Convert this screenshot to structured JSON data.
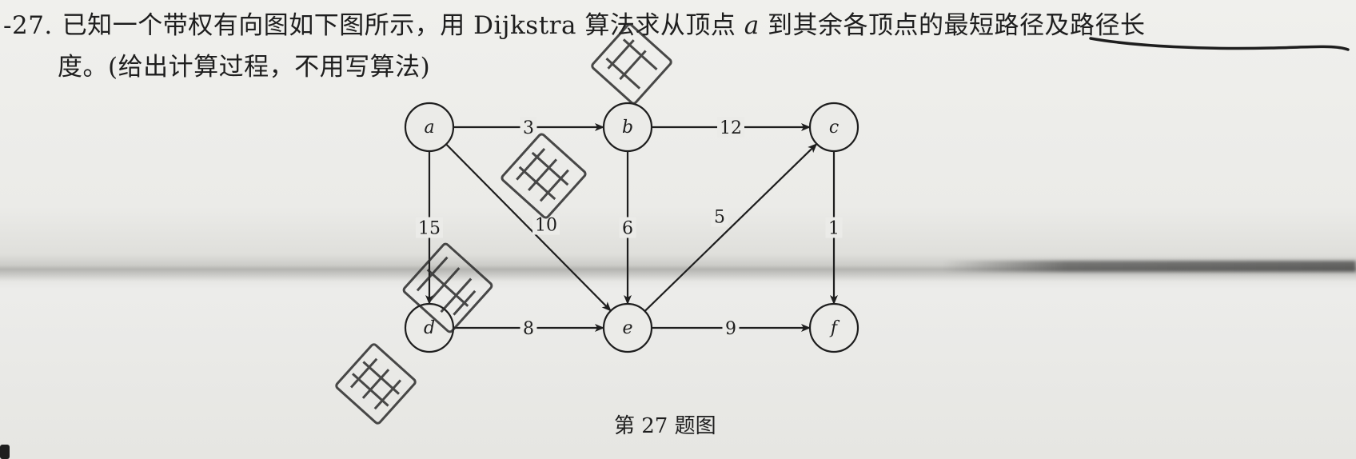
{
  "question": {
    "number": "-27.",
    "line1_before_var": "已知一个带权有向图如下图所示，用 Dijkstra 算法求从顶点 ",
    "start_vertex": "a",
    "line1_after_var": " 到其余各顶点的最短路径及路径长",
    "line2": "度。(给出计算过程，不用写算法)"
  },
  "graph": {
    "nodes": [
      {
        "id": "a",
        "label": "a"
      },
      {
        "id": "b",
        "label": "b"
      },
      {
        "id": "c",
        "label": "c"
      },
      {
        "id": "d",
        "label": "d"
      },
      {
        "id": "e",
        "label": "e"
      },
      {
        "id": "f",
        "label": "f"
      }
    ],
    "edges": [
      {
        "from": "a",
        "to": "b",
        "weight": "3"
      },
      {
        "from": "b",
        "to": "c",
        "weight": "12"
      },
      {
        "from": "a",
        "to": "d",
        "weight": "15"
      },
      {
        "from": "a",
        "to": "e",
        "weight": "10"
      },
      {
        "from": "b",
        "to": "e",
        "weight": "6"
      },
      {
        "from": "e",
        "to": "c",
        "weight": "5"
      },
      {
        "from": "c",
        "to": "f",
        "weight": "1"
      },
      {
        "from": "d",
        "to": "e",
        "weight": "8"
      },
      {
        "from": "e",
        "to": "f",
        "weight": "9"
      }
    ]
  },
  "caption": "第 27 题图",
  "colors": {
    "ink": "#1e1e1e",
    "paper": "#ebebe8",
    "watermark": "#2a2a2a"
  }
}
